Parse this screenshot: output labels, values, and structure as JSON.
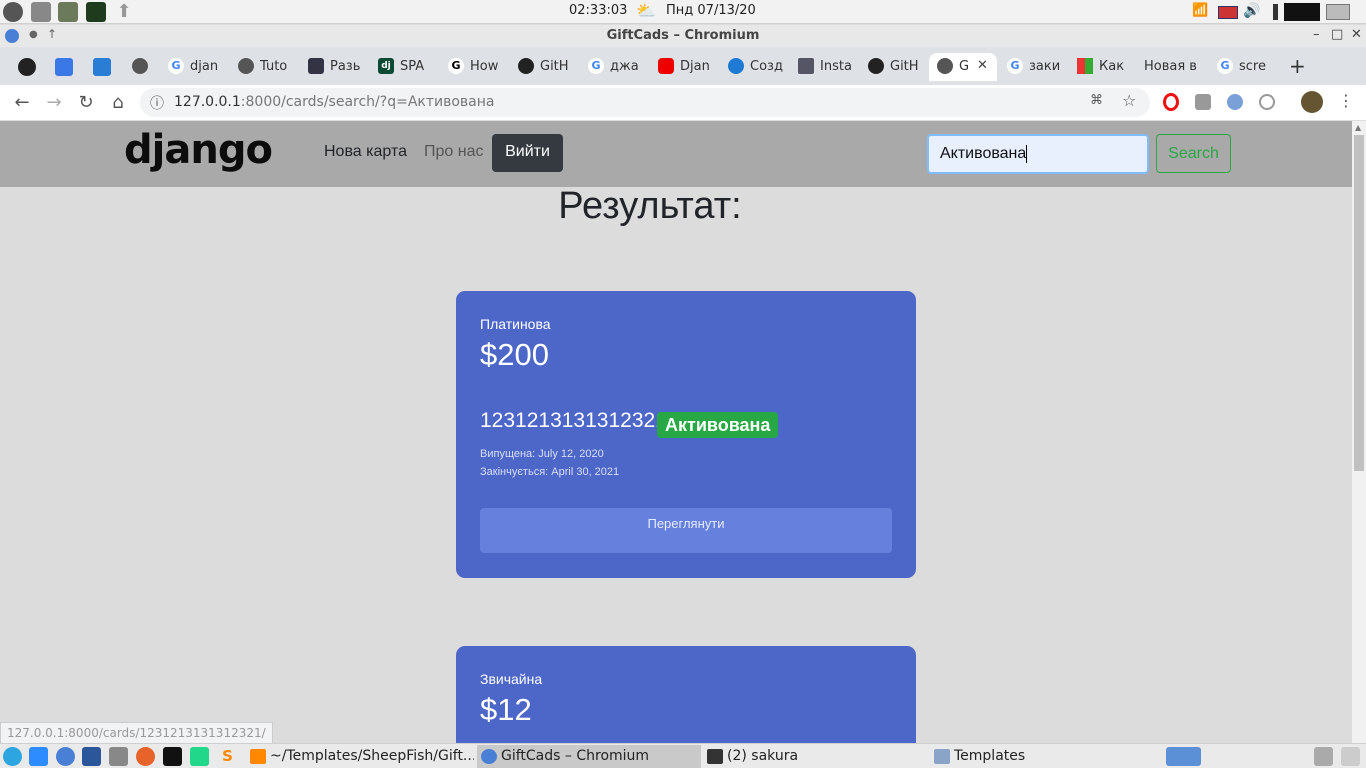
{
  "os": {
    "time": "02:33:03",
    "date": "Пнд 07/13/20"
  },
  "window": {
    "title": "GiftCads – Chromium"
  },
  "tabs": [
    {
      "label": "djan"
    },
    {
      "label": "Tuto"
    },
    {
      "label": "Разь"
    },
    {
      "label": "SPA"
    },
    {
      "label": "How"
    },
    {
      "label": "GitH"
    },
    {
      "label": "джа"
    },
    {
      "label": "Djan"
    },
    {
      "label": "Созд"
    },
    {
      "label": "Insta"
    },
    {
      "label": "GitH"
    },
    {
      "label": "G"
    },
    {
      "label": "заки"
    },
    {
      "label": "Как"
    },
    {
      "label": "Новая в"
    },
    {
      "label": "scre"
    }
  ],
  "toolbar": {
    "url_host": "127.0.0.1",
    "url_rest": ":8000/cards/search/?q=Активована"
  },
  "site": {
    "logo": "django",
    "nav_new_card": "Нова карта",
    "nav_about": "Про нас",
    "login": "Вийти",
    "search_value": "Активована",
    "search_button": "Search",
    "result_title": "Результат:"
  },
  "cards": [
    {
      "type": "Платинова",
      "price": "$200",
      "number": "1231213131312321",
      "badge": "Активована",
      "issued": "Випущена: July 12, 2020",
      "expires": "Закінчується: April 30, 2021",
      "view": "Переглянути"
    },
    {
      "type": "Звичайна",
      "price": "$12"
    }
  ],
  "status_url": "127.0.0.1:8000/cards/1231213131312321/",
  "taskbar": {
    "items": [
      {
        "label": "~/Templates/SheepFish/Gift..."
      },
      {
        "label": "GiftCads – Chromium"
      },
      {
        "label": "(2) sakura"
      },
      {
        "label": "Templates"
      }
    ]
  },
  "colors": {
    "card": "#4d67c8",
    "badge": "#28a745",
    "navbar": "#a9a9a9"
  }
}
